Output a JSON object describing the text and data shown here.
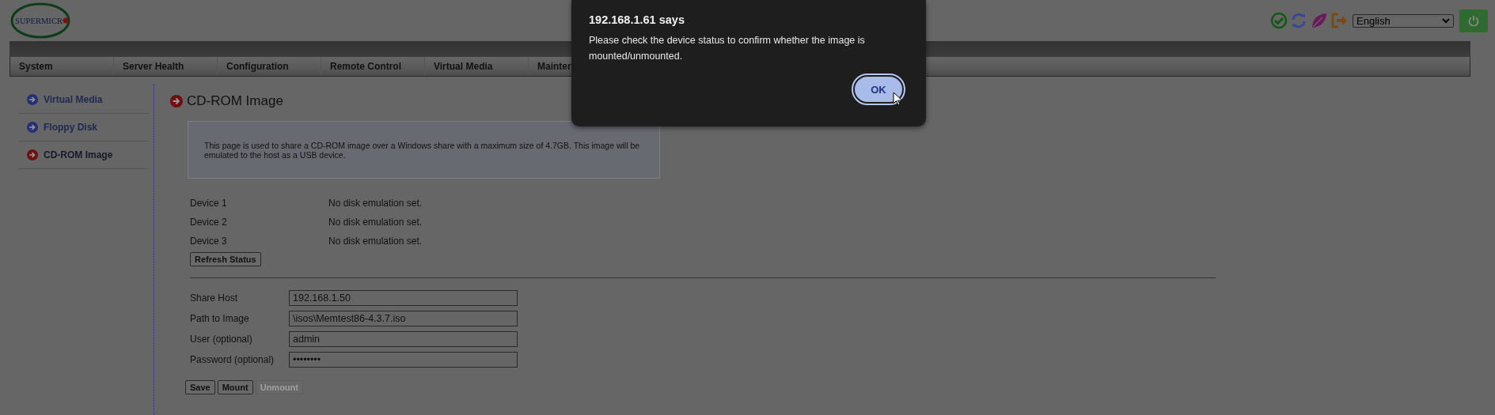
{
  "header": {
    "logo": "SUPERMICR",
    "language": "English"
  },
  "nav": [
    "System",
    "Server Health",
    "Configuration",
    "Remote Control",
    "Virtual Media",
    "Mainter"
  ],
  "sidebar": {
    "items": [
      {
        "label": "Virtual Media",
        "selected": false
      },
      {
        "label": "Floppy Disk",
        "selected": false
      },
      {
        "label": "CD-ROM Image",
        "selected": true
      }
    ]
  },
  "page": {
    "title": "CD-ROM Image",
    "description": "This page is used to share a CD-ROM image over a Windows share with a maximum size of 4.7GB. This image will be emulated to the host as a USB device.",
    "devices": [
      {
        "label": "Device 1",
        "status": "No disk emulation set."
      },
      {
        "label": "Device 2",
        "status": "No disk emulation set."
      },
      {
        "label": "Device 3",
        "status": "No disk emulation set."
      }
    ],
    "refresh_button": "Refresh Status",
    "fields": [
      {
        "label": "Share Host",
        "value": "192.168.1.50"
      },
      {
        "label": "Path to Image",
        "value": "\\isos\\Memtest86-4.3.7.iso"
      },
      {
        "label": "User (optional)",
        "value": "admin"
      },
      {
        "label": "Password (optional)",
        "value": "••••••••"
      }
    ],
    "buttons": [
      {
        "label": "Save",
        "disabled": false
      },
      {
        "label": "Mount",
        "disabled": false
      },
      {
        "label": "Unmount",
        "disabled": true
      }
    ]
  },
  "dialog": {
    "title": "192.168.1.61 says",
    "message": "Please check the device status to confirm whether the image is mounted/unmounted.",
    "button": "OK"
  }
}
